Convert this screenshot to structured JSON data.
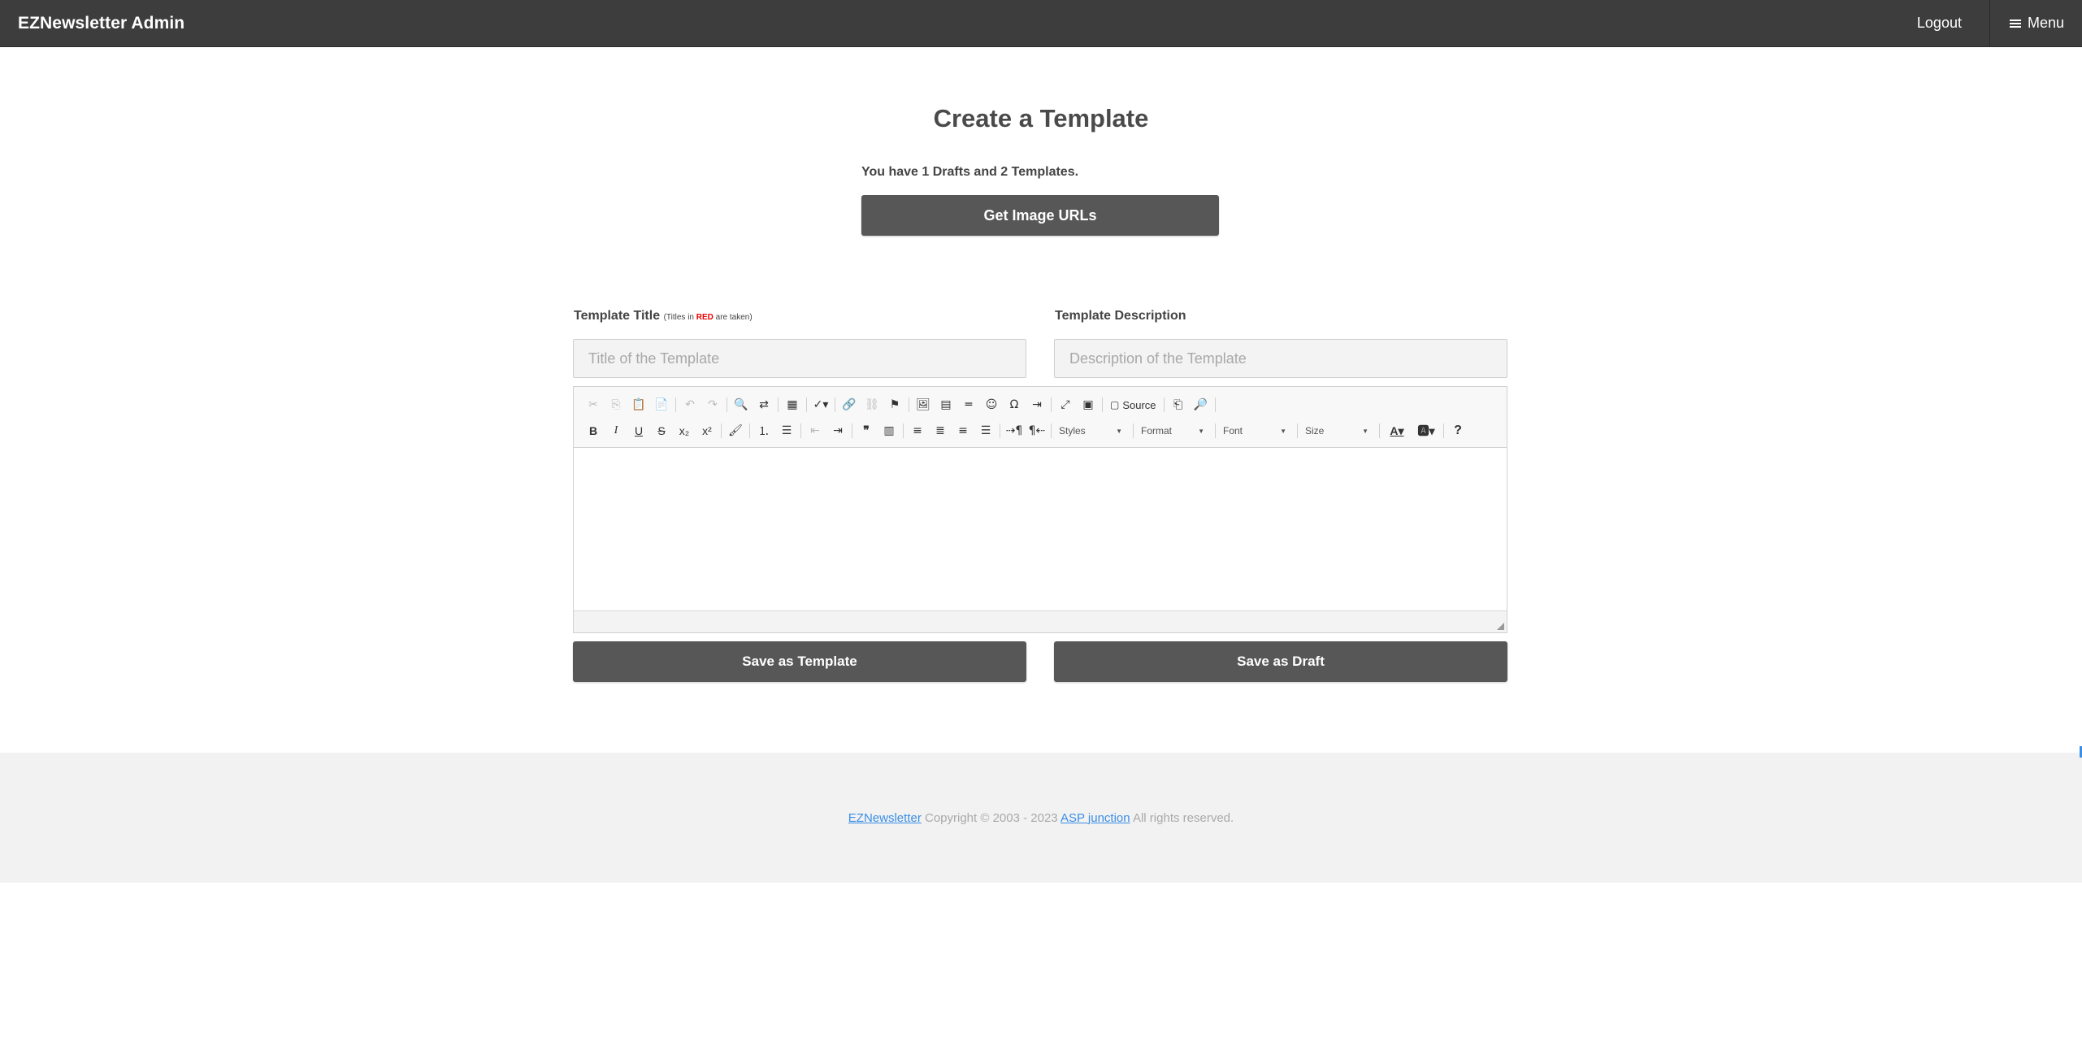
{
  "navbar": {
    "brand": "EZNewsletter Admin",
    "logout": "Logout",
    "menu": "Menu"
  },
  "main": {
    "title": "Create a Template",
    "counts_text": "You have 1 Drafts and 2 Templates.",
    "get_image_urls": "Get Image URLs"
  },
  "form": {
    "title_label": "Template Title",
    "title_note_prefix": "(Titles in ",
    "title_note_red": "RED",
    "title_note_suffix": " are taken)",
    "title_placeholder": "Title of the Template",
    "desc_label": "Template Description",
    "desc_placeholder": "Description of the Template",
    "save_template": "Save as Template",
    "save_draft": "Save as Draft"
  },
  "editor": {
    "source_label": "Source",
    "styles": "Styles",
    "format": "Format",
    "font": "Font",
    "size": "Size"
  },
  "footer": {
    "brand_link": "EZNewsletter",
    "copyright": " Copyright © 2003 - 2023 ",
    "company_link": "ASP junction",
    "rights": " All rights reserved."
  },
  "colors": {
    "navbar": "#3d3d3d",
    "button": "#575757",
    "link": "#3a8ee6",
    "taken": "#ee0000"
  }
}
